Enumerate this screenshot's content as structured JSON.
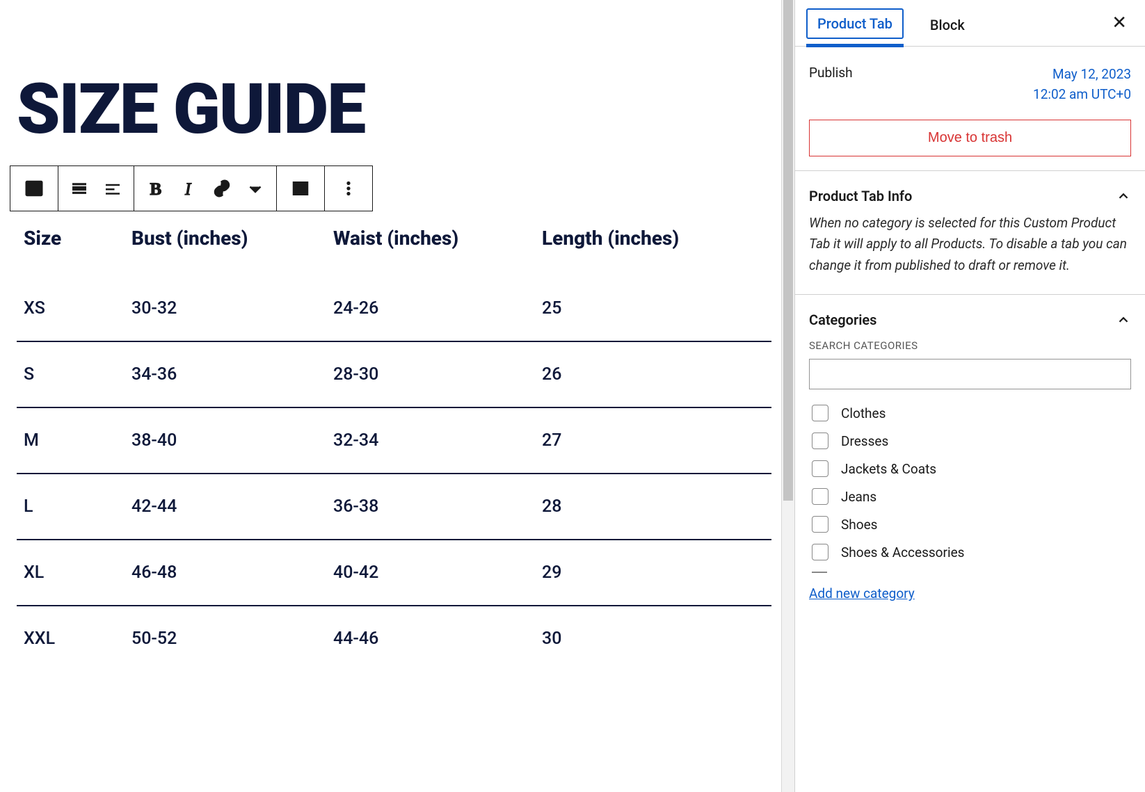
{
  "title": "SIZE GUIDE",
  "table": {
    "headers": [
      "Size",
      "Bust (inches)",
      "Waist (inches)",
      "Length (inches)"
    ],
    "rows": [
      [
        "XS",
        "30-32",
        "24-26",
        "25"
      ],
      [
        "S",
        "34-36",
        "28-30",
        "26"
      ],
      [
        "M",
        "38-40",
        "32-34",
        "27"
      ],
      [
        "L",
        "42-44",
        "36-38",
        "28"
      ],
      [
        "XL",
        "46-48",
        "40-42",
        "29"
      ],
      [
        "XXL",
        "50-52",
        "44-46",
        "30"
      ]
    ]
  },
  "sidebar": {
    "tabs": {
      "product_tab": "Product Tab",
      "block": "Block"
    },
    "publish_label": "Publish",
    "publish_date_line1": "May 12, 2023",
    "publish_date_line2": "12:02 am UTC+0",
    "trash_label": "Move to trash",
    "info_panel": {
      "title": "Product Tab Info",
      "desc": "When no category is selected for this Custom Product Tab it will apply to all Products. To disable a tab you can change it from published to draft or remove it."
    },
    "categories_panel": {
      "title": "Categories",
      "search_label": "SEARCH CATEGORIES",
      "items": [
        "Clothes",
        "Dresses",
        "Jackets & Coats",
        "Jeans",
        "Shoes",
        "Shoes & Accessories"
      ],
      "add_new": "Add new category"
    }
  }
}
